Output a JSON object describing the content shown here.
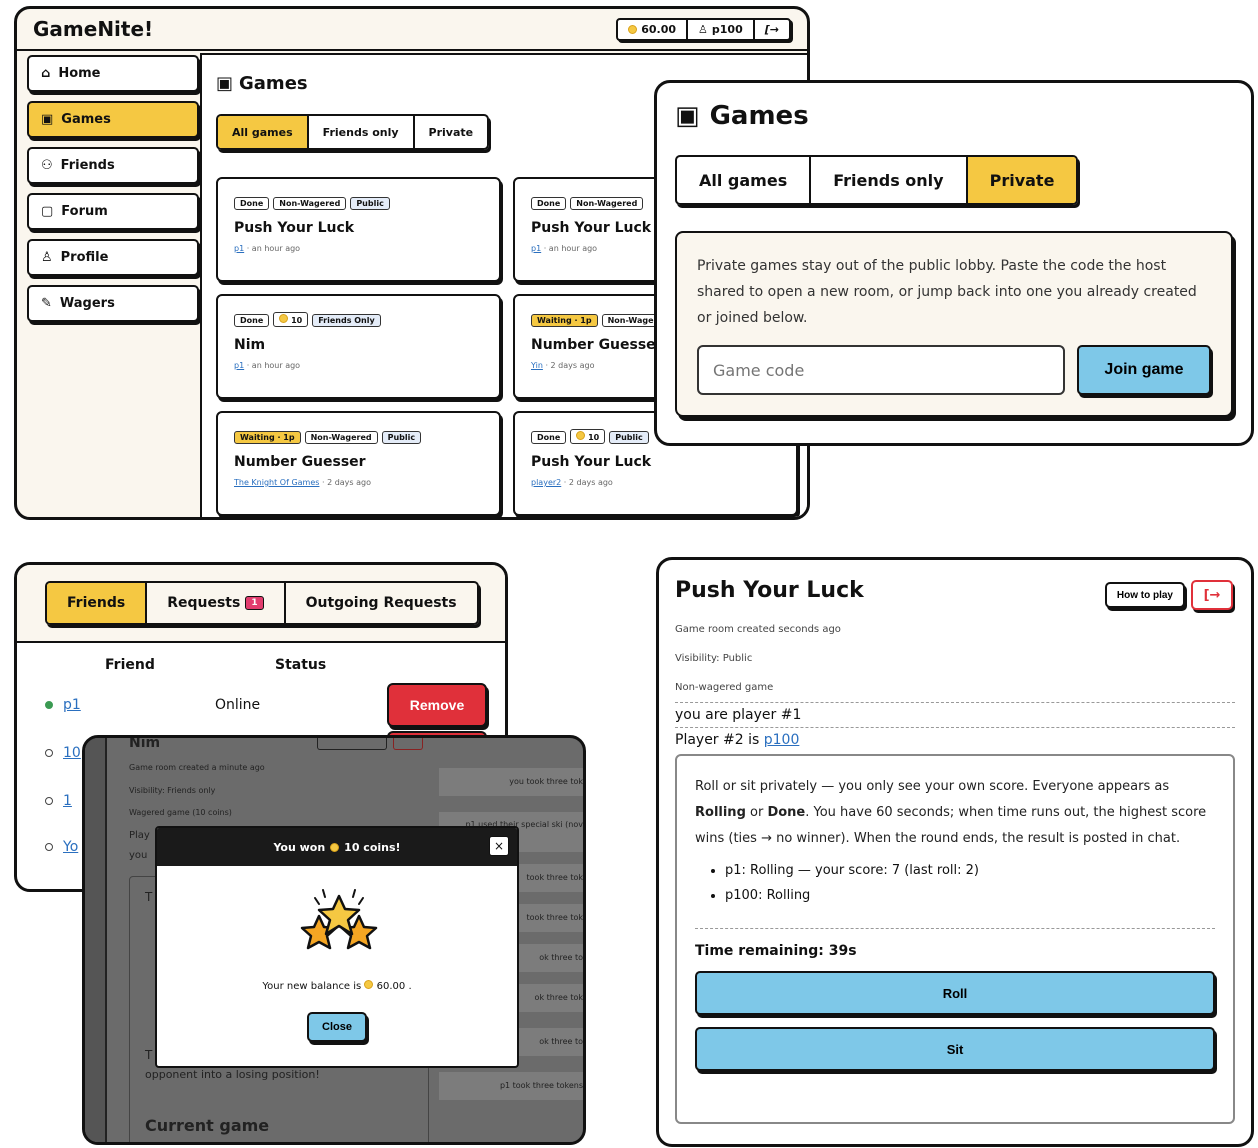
{
  "lobby": {
    "logo": "GameNite!",
    "balance": "60.00",
    "username": "p100",
    "logout_icon": "[→",
    "nav": [
      {
        "label": "Home",
        "icon": "⌂"
      },
      {
        "label": "Games",
        "icon": "▣"
      },
      {
        "label": "Friends",
        "icon": "⚇"
      },
      {
        "label": "Forum",
        "icon": "▢"
      },
      {
        "label": "Profile",
        "icon": "♙"
      },
      {
        "label": "Wagers",
        "icon": "✎"
      }
    ],
    "title": "Games",
    "tabs": [
      "All games",
      "Friends only",
      "Private"
    ],
    "cards": [
      {
        "badges": [
          "Done",
          "Non-Wagered",
          "Public"
        ],
        "title": "Push Your Luck",
        "who": "p1",
        "when": "· an hour ago"
      },
      {
        "badges": [
          "Done",
          "Non-Wagered"
        ],
        "title": "Push Your Luck",
        "who": "p1",
        "when": "· an hour ago"
      },
      {
        "badges": [
          "Done",
          "10",
          "Friends Only"
        ],
        "title": "Nim",
        "who": "p1",
        "when": "· an hour ago"
      },
      {
        "badges": [
          "Waiting · 1p",
          "Non-Wage"
        ],
        "title": "Number Guesser",
        "who": "Yin",
        "when": "· 2 days ago"
      },
      {
        "badges": [
          "Waiting · 1p",
          "Non-Wagered",
          "Public"
        ],
        "title": "Number Guesser",
        "who": "The Knight Of Games",
        "when": "· 2 days ago"
      },
      {
        "badges": [
          "Done",
          "10",
          "Public"
        ],
        "title": "Push Your Luck",
        "who": "player2",
        "when": "· 2 days ago"
      }
    ]
  },
  "private": {
    "title": "Games",
    "tabs": [
      "All games",
      "Friends only",
      "Private"
    ],
    "description": "Private games stay out of the public lobby. Paste the code the host shared to open a new room, or jump back into one you already created or joined below.",
    "placeholder": "Game code",
    "join_label": "Join game"
  },
  "friends": {
    "tabs": [
      "Friends",
      "Requests",
      "Outgoing Requests"
    ],
    "request_count": "1",
    "col_friend": "Friend",
    "col_status": "Status",
    "rows": [
      {
        "name": "p1",
        "status": "Online"
      },
      {
        "name": "10"
      },
      {
        "name": "1"
      },
      {
        "name": "Yo"
      }
    ],
    "remove_label": "Remove"
  },
  "win": {
    "bg_title": "Nim",
    "bg_created": "Game room created a minute ago",
    "bg_visibility": "Visibility: Friends only",
    "bg_wager": "Wagered game (10 coins)",
    "bg_player": "Play",
    "bg_you": "you",
    "bg_partial_t": "T",
    "bg_text": "opponent into a losing position!",
    "bg_current": "Current game",
    "chat": [
      "you took three tok",
      "p1 used their special ski (nov",
      "took three tok",
      "took three tok",
      "ok three to",
      "ok three tok",
      "ok three to",
      "p1 took three tokens"
    ],
    "modal_title_pre": "You won",
    "modal_title_post": "10 coins!",
    "close_x": "×",
    "balance_pre": "Your new balance is",
    "balance_val": "60.00",
    "close_label": "Close"
  },
  "room": {
    "title": "Push Your Luck",
    "howto_label": "How to play",
    "exit_icon": "[→",
    "created": "Game room created seconds ago",
    "visibility": "Visibility: Public",
    "wager": "Non-wagered game",
    "you_are": "you are player #1",
    "player2_pre": "Player #2 is ",
    "player2_name": "p100",
    "rules_1": "Roll or sit privately — you only see your own score. Everyone appears as ",
    "rolling": "Rolling",
    "or": " or ",
    "done": "Done",
    "rules_2": ". You have 60 seconds; when time runs out, the highest score wins (ties → no winner). When the round ends, the result is posted in chat.",
    "status": [
      "p1: Rolling — your score: 7 (last roll: 2)",
      "p100: Rolling"
    ],
    "time": "Time remaining: 39s",
    "roll_label": "Roll",
    "sit_label": "Sit"
  }
}
